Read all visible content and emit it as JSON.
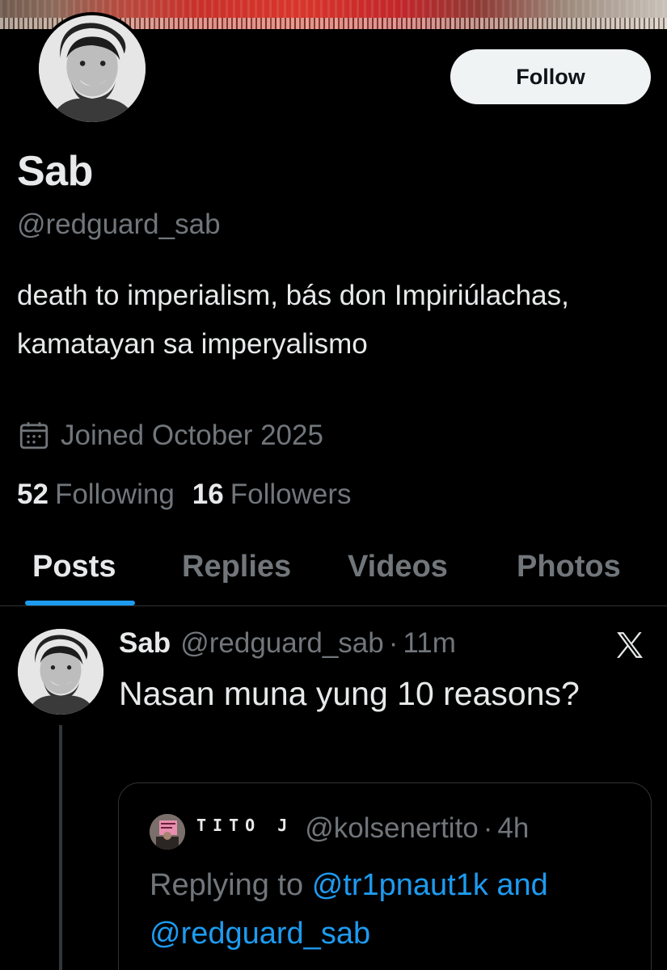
{
  "profile": {
    "name": "Sab",
    "handle": "@redguard_sab",
    "bio": "death to imperialism, bás don Impiriúlachas, kamatayan sa imperyalismo",
    "joined": "Joined October 2025",
    "following_count": "52",
    "following_label": "Following",
    "followers_count": "16",
    "followers_label": "Followers",
    "follow_button": "Follow"
  },
  "tabs": [
    {
      "label": "Posts",
      "active": true
    },
    {
      "label": "Replies",
      "active": false
    },
    {
      "label": "Videos",
      "active": false
    },
    {
      "label": "Photos",
      "active": false
    }
  ],
  "tweet": {
    "name": "Sab",
    "handle": "@redguard_sab",
    "separator": "·",
    "time": "11m",
    "text": "Nasan muna yung 10 reasons?",
    "logo_icon": "x-logo-icon"
  },
  "quoted": {
    "name": "TITO J",
    "handle": "@kolsenertito",
    "separator": "·",
    "time": "4h",
    "replying_prefix": "Replying to",
    "mention1": "@tr1pnaut1k",
    "and": "and",
    "mention2": "@redguard_sab"
  },
  "colors": {
    "background": "#000000",
    "text_primary": "#e7e9ea",
    "text_secondary": "#71767b",
    "accent": "#1d9bf0",
    "border": "#2f3336",
    "follow_bg": "#eff3f4"
  }
}
